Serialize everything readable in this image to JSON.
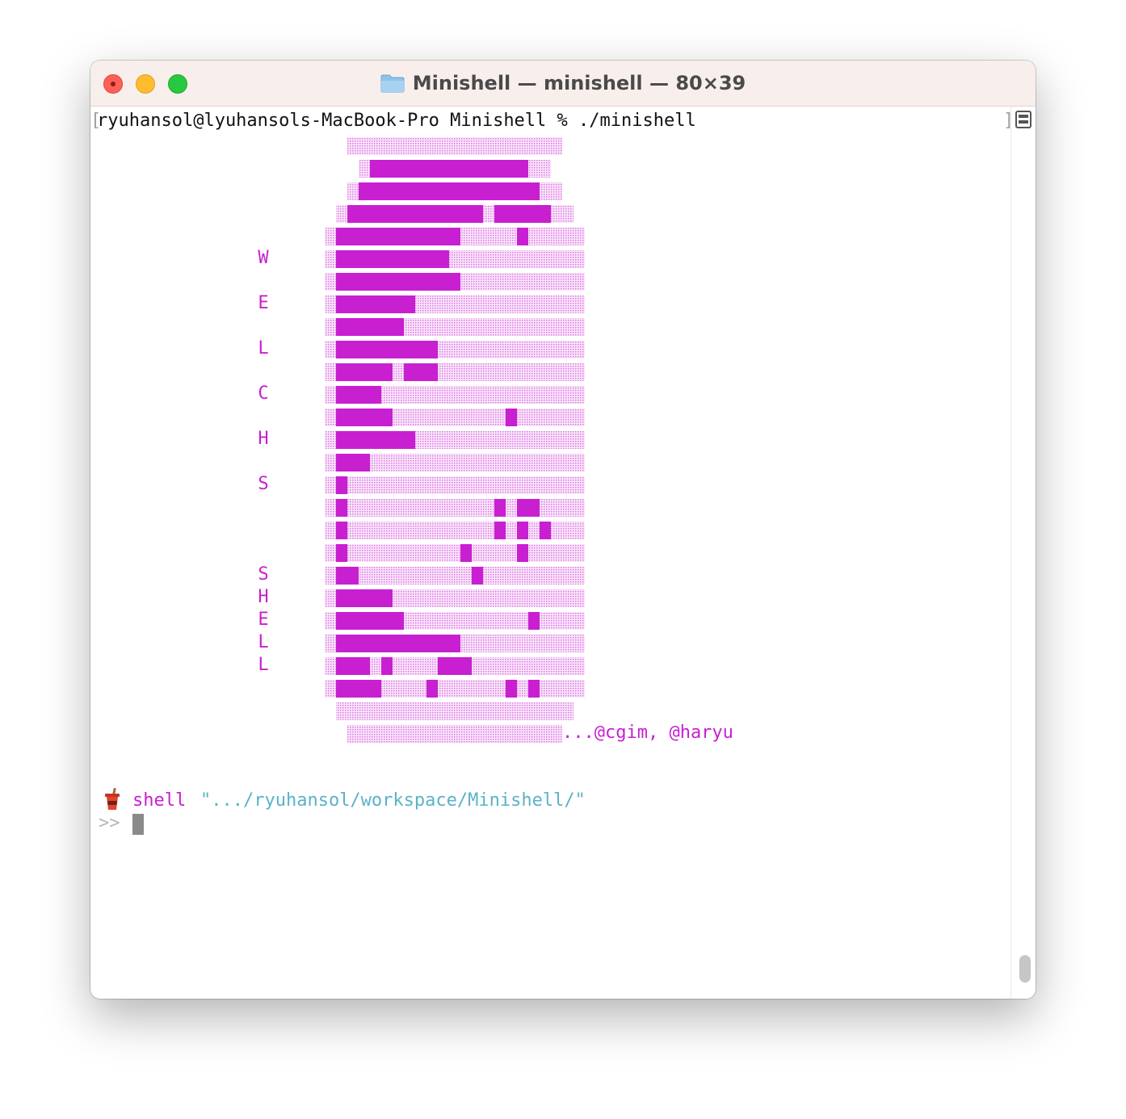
{
  "window": {
    "title": "Minishell — minishell — 80×39",
    "folder_icon": "folder-icon",
    "traffic_lights": [
      "close-button",
      "minimize-button",
      "zoom-button"
    ]
  },
  "terminal": {
    "command_prompt": "ryuhansol@lyuhansols-MacBook-Pro Minishell % ./minishell",
    "welcome_letters": [
      "W",
      "E",
      "L",
      "C",
      "H",
      "S"
    ],
    "shell_letters": [
      "S",
      "H",
      "E",
      "L",
      "L"
    ],
    "credit": "...@cgim, @haryu",
    "shell_label": "shell",
    "path": "\".../ryuhansol/workspace/Minishell/\"",
    "input_prompt": ">>",
    "input_value": ""
  },
  "colors": {
    "accent": "#c81fd1",
    "light": "#f0c2f2",
    "path": "#5ab3c6",
    "title_bg": "#f8efec"
  },
  "icons": {
    "cup": "drink-cup-icon",
    "split": "split-pane-icon"
  }
}
